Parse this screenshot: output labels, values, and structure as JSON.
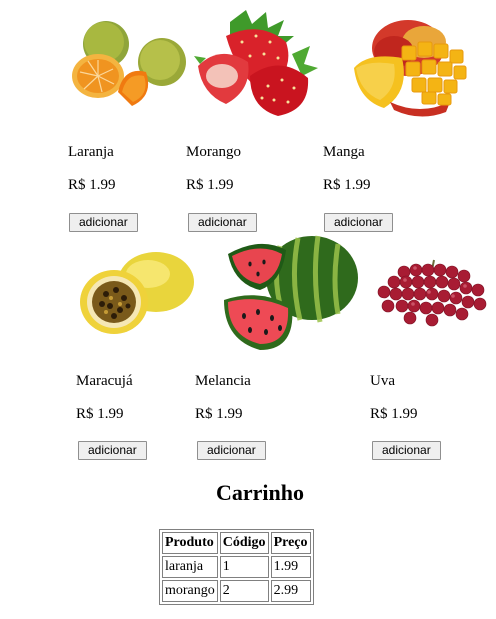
{
  "products": [
    {
      "name": "Laranja",
      "price": "R$ 1.99",
      "button": "adicionar"
    },
    {
      "name": "Morango",
      "price": "R$ 1.99",
      "button": "adicionar"
    },
    {
      "name": "Manga",
      "price": "R$ 1.99",
      "button": "adicionar"
    },
    {
      "name": "Maracujá",
      "price": "R$ 1.99",
      "button": "adicionar"
    },
    {
      "name": "Melancia",
      "price": "R$ 1.99",
      "button": "adicionar"
    },
    {
      "name": "Uva",
      "price": "R$ 1.99",
      "button": "adicionar"
    }
  ],
  "cart": {
    "title": "Carrinho",
    "headers": [
      "Produto",
      "Código",
      "Preço"
    ],
    "rows": [
      [
        "laranja",
        "1",
        "1.99"
      ],
      [
        "morango",
        "2",
        "2.99"
      ]
    ]
  }
}
